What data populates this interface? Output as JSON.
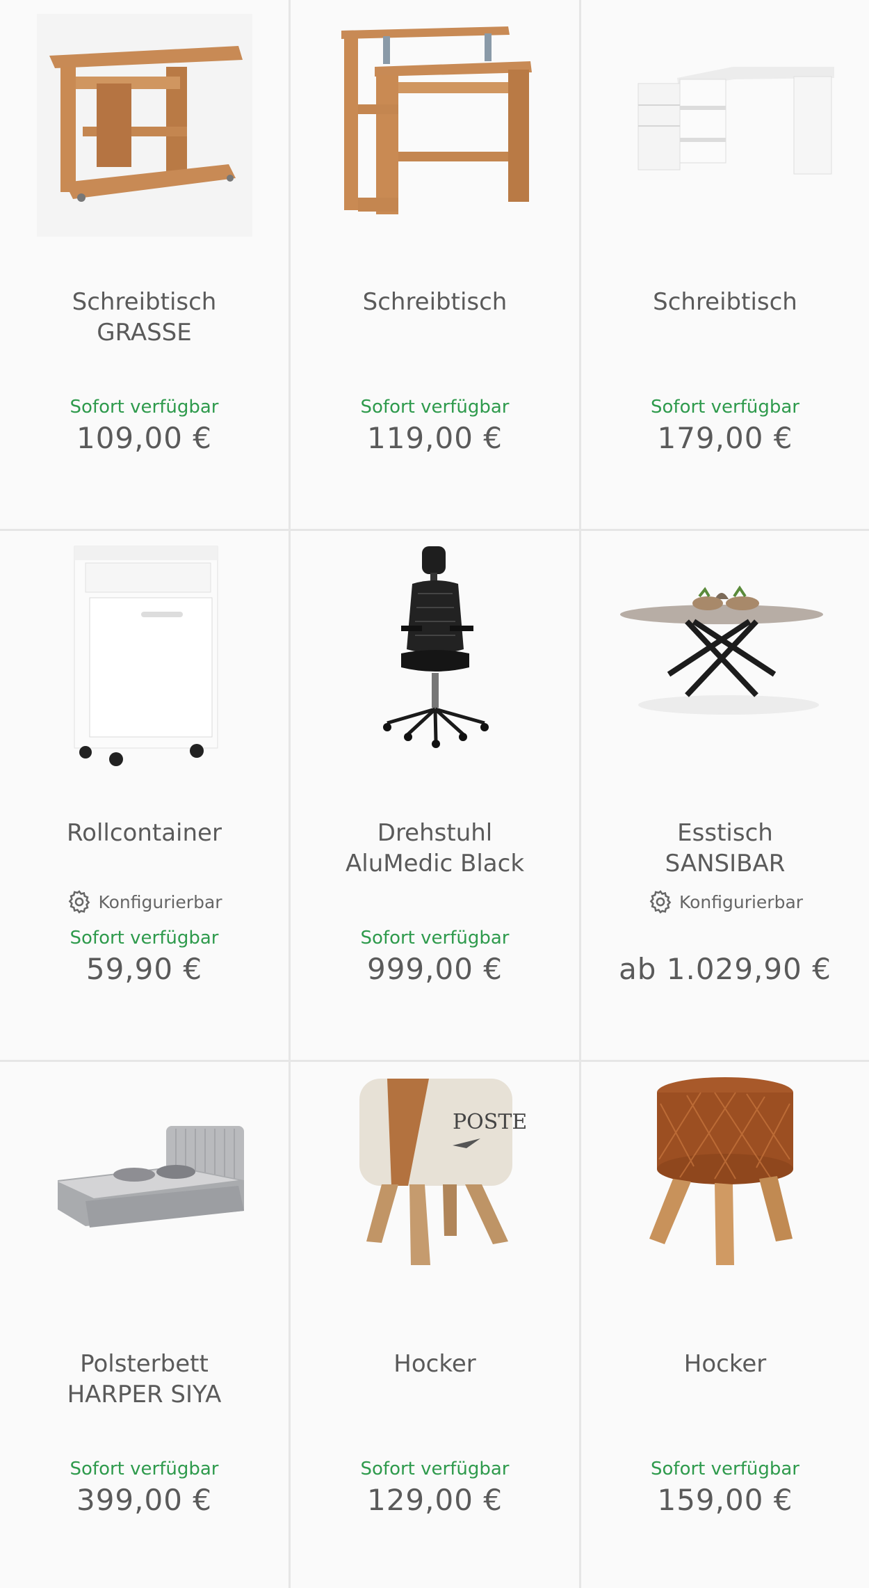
{
  "products": [
    {
      "title_line1": "Schreibtisch",
      "title_line2": "GRASSE",
      "configurable": "",
      "availability": "Sofort verfügbar",
      "price": "109,00 €"
    },
    {
      "title_line1": "Schreibtisch",
      "title_line2": "",
      "configurable": "",
      "availability": "Sofort verfügbar",
      "price": "119,00 €"
    },
    {
      "title_line1": "Schreibtisch",
      "title_line2": "",
      "configurable": "",
      "availability": "Sofort verfügbar",
      "price": "179,00 €"
    },
    {
      "title_line1": "Rollcontainer",
      "title_line2": "",
      "configurable": "Konfigurierbar",
      "availability": "Sofort verfügbar",
      "price": "59,90 €"
    },
    {
      "title_line1": "Drehstuhl",
      "title_line2": "AluMedic Black",
      "configurable": "",
      "availability": "Sofort verfügbar",
      "price": "999,00 €"
    },
    {
      "title_line1": "Esstisch",
      "title_line2": "SANSIBAR",
      "configurable": "Konfigurierbar",
      "availability": "",
      "price": "ab 1.029,90 €"
    },
    {
      "title_line1": "Polsterbett",
      "title_line2": "HARPER SIYA",
      "configurable": "",
      "availability": "Sofort verfügbar",
      "price": "399,00 €"
    },
    {
      "title_line1": "Hocker",
      "title_line2": "",
      "configurable": "",
      "availability": "Sofort verfügbar",
      "price": "129,00 €"
    },
    {
      "title_line1": "Hocker",
      "title_line2": "",
      "configurable": "",
      "availability": "Sofort verfügbar",
      "price": "159,00 €"
    }
  ],
  "icons": {
    "product_images": [
      "desk-image",
      "desk-image",
      "corner-desk-image",
      "roll-container-image",
      "office-chair-image",
      "dining-table-image",
      "upholstered-bed-image",
      "stool-image",
      "stool-image"
    ],
    "configurable": "gear-icon"
  },
  "colors": {
    "availability_green": "#2e9a4c",
    "text_gray": "#5a5a5a",
    "background": "#fafafa",
    "divider": "#e6e6e6"
  }
}
